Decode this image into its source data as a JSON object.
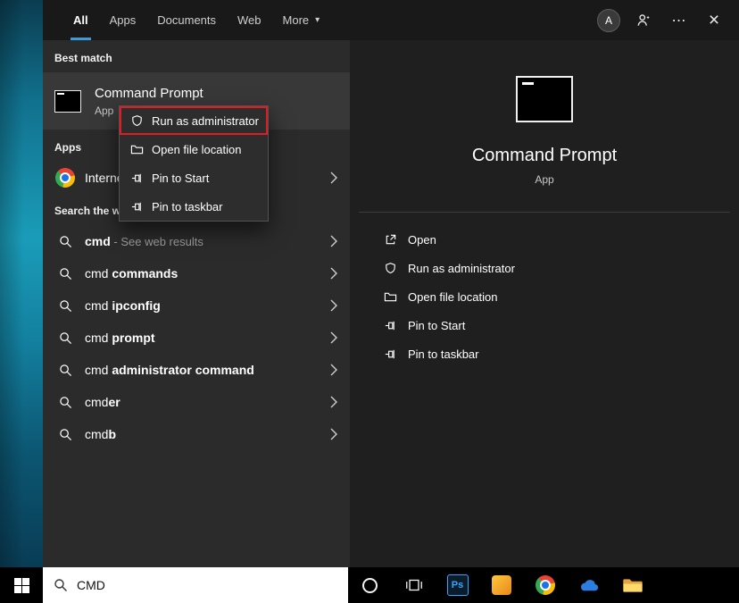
{
  "colors": {
    "accent_blue": "#3f9bd8",
    "highlight_red": "#e01b24",
    "taskbar": "#000000"
  },
  "header": {
    "tabs": [
      {
        "label": "All"
      },
      {
        "label": "Apps"
      },
      {
        "label": "Documents"
      },
      {
        "label": "Web"
      },
      {
        "label": "More"
      }
    ],
    "active_tab": "All",
    "avatar_letter": "A"
  },
  "left_panel": {
    "best_match_label": "Best match",
    "best_match": {
      "title": "Command Prompt",
      "subtitle": "App"
    },
    "apps_label": "Apps",
    "internet_item_label": "Interne",
    "search_web_label": "Search the w",
    "suggestions": [
      {
        "bold": "cmd",
        "note": " - See web results"
      },
      {
        "typed": "cmd",
        "bold": " commands"
      },
      {
        "typed": "cmd",
        "bold": " ipconfig"
      },
      {
        "typed": "cmd",
        "bold": " prompt"
      },
      {
        "typed": "cmd",
        "bold": " administrator command"
      },
      {
        "typed": "cmd",
        "bold": "er"
      },
      {
        "typed": "cmd",
        "bold": "b"
      }
    ]
  },
  "context_menu": {
    "highlighted_item": "Run as administrator",
    "items": [
      {
        "label": "Run as administrator"
      },
      {
        "label": "Open file location"
      },
      {
        "label": "Pin to Start"
      },
      {
        "label": "Pin to taskbar"
      }
    ]
  },
  "preview": {
    "title": "Command Prompt",
    "subtitle": "App",
    "actions": [
      {
        "label": "Open"
      },
      {
        "label": "Run as administrator"
      },
      {
        "label": "Open file location"
      },
      {
        "label": "Pin to Start"
      },
      {
        "label": "Pin to taskbar"
      }
    ]
  },
  "taskbar": {
    "search_value": "CMD"
  }
}
